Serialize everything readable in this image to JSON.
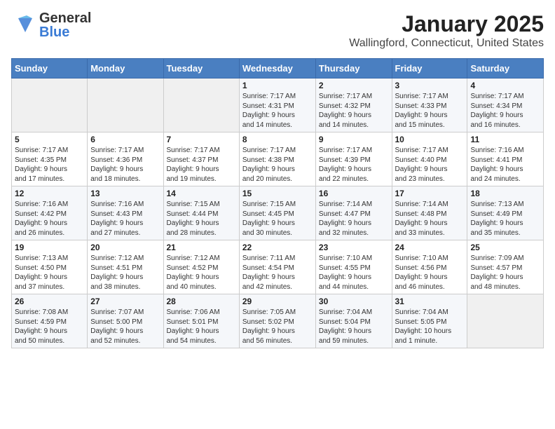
{
  "header": {
    "logo_general": "General",
    "logo_blue": "Blue",
    "title": "January 2025",
    "subtitle": "Wallingford, Connecticut, United States"
  },
  "calendar": {
    "days_of_week": [
      "Sunday",
      "Monday",
      "Tuesday",
      "Wednesday",
      "Thursday",
      "Friday",
      "Saturday"
    ],
    "weeks": [
      [
        {
          "day": "",
          "info": ""
        },
        {
          "day": "",
          "info": ""
        },
        {
          "day": "",
          "info": ""
        },
        {
          "day": "1",
          "info": "Sunrise: 7:17 AM\nSunset: 4:31 PM\nDaylight: 9 hours\nand 14 minutes."
        },
        {
          "day": "2",
          "info": "Sunrise: 7:17 AM\nSunset: 4:32 PM\nDaylight: 9 hours\nand 14 minutes."
        },
        {
          "day": "3",
          "info": "Sunrise: 7:17 AM\nSunset: 4:33 PM\nDaylight: 9 hours\nand 15 minutes."
        },
        {
          "day": "4",
          "info": "Sunrise: 7:17 AM\nSunset: 4:34 PM\nDaylight: 9 hours\nand 16 minutes."
        }
      ],
      [
        {
          "day": "5",
          "info": "Sunrise: 7:17 AM\nSunset: 4:35 PM\nDaylight: 9 hours\nand 17 minutes."
        },
        {
          "day": "6",
          "info": "Sunrise: 7:17 AM\nSunset: 4:36 PM\nDaylight: 9 hours\nand 18 minutes."
        },
        {
          "day": "7",
          "info": "Sunrise: 7:17 AM\nSunset: 4:37 PM\nDaylight: 9 hours\nand 19 minutes."
        },
        {
          "day": "8",
          "info": "Sunrise: 7:17 AM\nSunset: 4:38 PM\nDaylight: 9 hours\nand 20 minutes."
        },
        {
          "day": "9",
          "info": "Sunrise: 7:17 AM\nSunset: 4:39 PM\nDaylight: 9 hours\nand 22 minutes."
        },
        {
          "day": "10",
          "info": "Sunrise: 7:17 AM\nSunset: 4:40 PM\nDaylight: 9 hours\nand 23 minutes."
        },
        {
          "day": "11",
          "info": "Sunrise: 7:16 AM\nSunset: 4:41 PM\nDaylight: 9 hours\nand 24 minutes."
        }
      ],
      [
        {
          "day": "12",
          "info": "Sunrise: 7:16 AM\nSunset: 4:42 PM\nDaylight: 9 hours\nand 26 minutes."
        },
        {
          "day": "13",
          "info": "Sunrise: 7:16 AM\nSunset: 4:43 PM\nDaylight: 9 hours\nand 27 minutes."
        },
        {
          "day": "14",
          "info": "Sunrise: 7:15 AM\nSunset: 4:44 PM\nDaylight: 9 hours\nand 28 minutes."
        },
        {
          "day": "15",
          "info": "Sunrise: 7:15 AM\nSunset: 4:45 PM\nDaylight: 9 hours\nand 30 minutes."
        },
        {
          "day": "16",
          "info": "Sunrise: 7:14 AM\nSunset: 4:47 PM\nDaylight: 9 hours\nand 32 minutes."
        },
        {
          "day": "17",
          "info": "Sunrise: 7:14 AM\nSunset: 4:48 PM\nDaylight: 9 hours\nand 33 minutes."
        },
        {
          "day": "18",
          "info": "Sunrise: 7:13 AM\nSunset: 4:49 PM\nDaylight: 9 hours\nand 35 minutes."
        }
      ],
      [
        {
          "day": "19",
          "info": "Sunrise: 7:13 AM\nSunset: 4:50 PM\nDaylight: 9 hours\nand 37 minutes."
        },
        {
          "day": "20",
          "info": "Sunrise: 7:12 AM\nSunset: 4:51 PM\nDaylight: 9 hours\nand 38 minutes."
        },
        {
          "day": "21",
          "info": "Sunrise: 7:12 AM\nSunset: 4:52 PM\nDaylight: 9 hours\nand 40 minutes."
        },
        {
          "day": "22",
          "info": "Sunrise: 7:11 AM\nSunset: 4:54 PM\nDaylight: 9 hours\nand 42 minutes."
        },
        {
          "day": "23",
          "info": "Sunrise: 7:10 AM\nSunset: 4:55 PM\nDaylight: 9 hours\nand 44 minutes."
        },
        {
          "day": "24",
          "info": "Sunrise: 7:10 AM\nSunset: 4:56 PM\nDaylight: 9 hours\nand 46 minutes."
        },
        {
          "day": "25",
          "info": "Sunrise: 7:09 AM\nSunset: 4:57 PM\nDaylight: 9 hours\nand 48 minutes."
        }
      ],
      [
        {
          "day": "26",
          "info": "Sunrise: 7:08 AM\nSunset: 4:59 PM\nDaylight: 9 hours\nand 50 minutes."
        },
        {
          "day": "27",
          "info": "Sunrise: 7:07 AM\nSunset: 5:00 PM\nDaylight: 9 hours\nand 52 minutes."
        },
        {
          "day": "28",
          "info": "Sunrise: 7:06 AM\nSunset: 5:01 PM\nDaylight: 9 hours\nand 54 minutes."
        },
        {
          "day": "29",
          "info": "Sunrise: 7:05 AM\nSunset: 5:02 PM\nDaylight: 9 hours\nand 56 minutes."
        },
        {
          "day": "30",
          "info": "Sunrise: 7:04 AM\nSunset: 5:04 PM\nDaylight: 9 hours\nand 59 minutes."
        },
        {
          "day": "31",
          "info": "Sunrise: 7:04 AM\nSunset: 5:05 PM\nDaylight: 10 hours\nand 1 minute."
        },
        {
          "day": "",
          "info": ""
        }
      ]
    ]
  }
}
